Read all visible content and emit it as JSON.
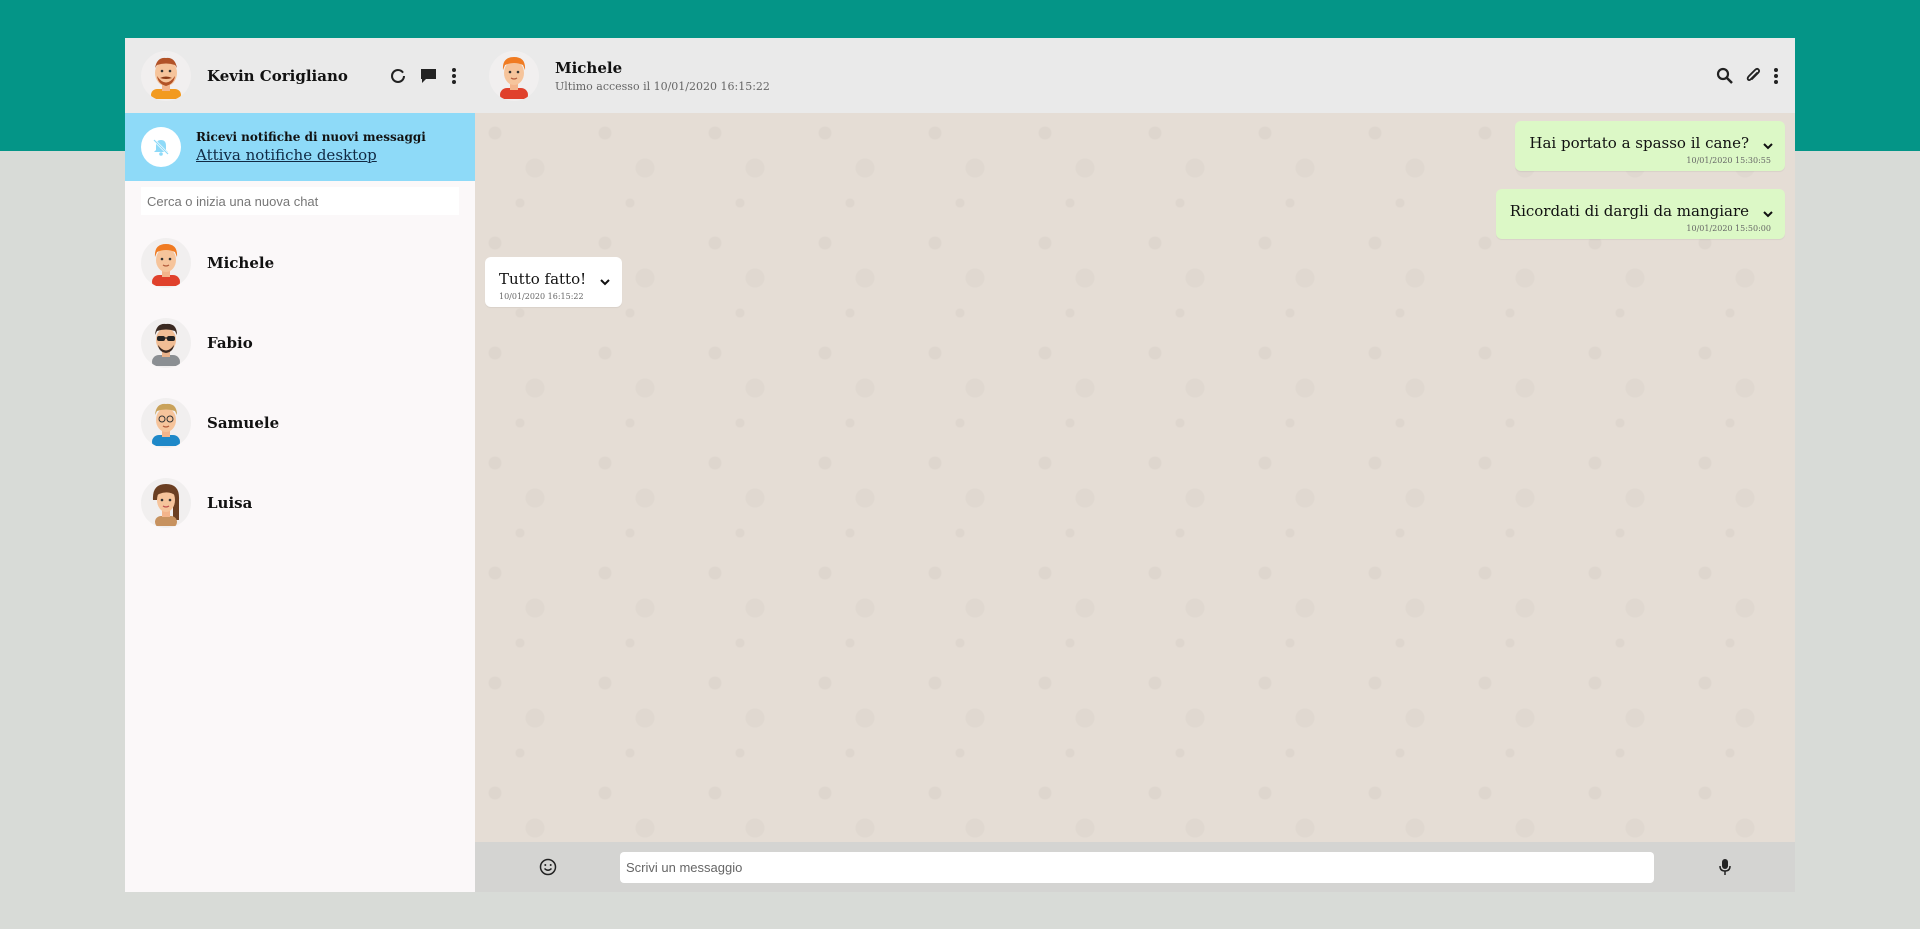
{
  "user": {
    "name": "Kevin Corigliano"
  },
  "notification": {
    "title": "Ricevi notifiche di nuovi messaggi",
    "link": "Attiva notifiche desktop"
  },
  "search": {
    "placeholder": "Cerca o inizia una nuova chat"
  },
  "contacts": [
    {
      "name": "Michele"
    },
    {
      "name": "Fabio"
    },
    {
      "name": "Samuele"
    },
    {
      "name": "Luisa"
    }
  ],
  "chat": {
    "name": "Michele",
    "status": "Ultimo accesso il 10/01/2020 16:15:22",
    "messages": [
      {
        "direction": "sent",
        "text": "Hai portato a spasso il cane?",
        "time": "10/01/2020 15:30:55"
      },
      {
        "direction": "sent",
        "text": "Ricordati di dargli da mangiare",
        "time": "10/01/2020 15:50:00"
      },
      {
        "direction": "received",
        "text": "Tutto fatto!",
        "time": "10/01/2020 16:15:22"
      }
    ]
  },
  "composer": {
    "placeholder": "Scrivi un messaggio"
  },
  "colors": {
    "brand_band": "#049587",
    "page_background": "#d8dbd7",
    "notify_banner": "#8edaf8",
    "sent_bubble": "#dcf8c6",
    "received_bubble": "#ffffff",
    "chat_background": "#e5ddd5"
  },
  "icons": {
    "header": [
      "status-icon",
      "chat-icon",
      "menu-dots-icon"
    ],
    "chat_header": [
      "search-icon",
      "paperclip-icon",
      "menu-dots-icon"
    ],
    "composer": [
      "emoji-icon",
      "microphone-icon"
    ]
  }
}
